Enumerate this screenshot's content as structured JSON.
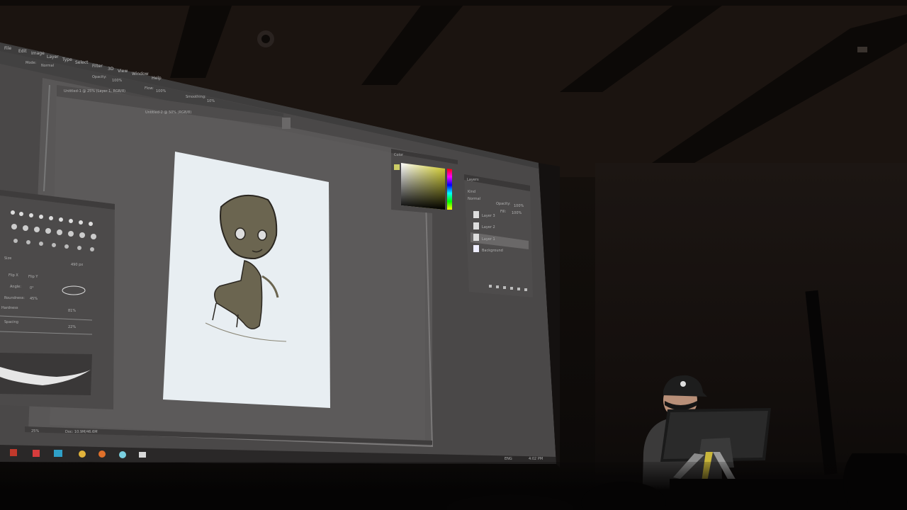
{
  "scene": {
    "description_type": "photo-of-projected-screen",
    "app": "Photoshop"
  },
  "menu_bar": {
    "items": [
      "File",
      "Edit",
      "Image",
      "Layer",
      "Type",
      "Select",
      "Filter",
      "3D",
      "View",
      "Window",
      "Help"
    ]
  },
  "options_bar": {
    "mode_label": "Mode:",
    "mode_value": "Normal",
    "opacity_label": "Opacity:",
    "opacity_value": "100%",
    "flow_label": "Flow:",
    "flow_value": "100%",
    "smoothing_label": "Smoothing:",
    "smoothing_value": "10%"
  },
  "documents": {
    "tab1": "Untitled-1 @ 25% (Layer 1, RGB/8)",
    "tab2": "Untitled-2 @ 50% (RGB/8)"
  },
  "status_bar": {
    "zoom": "25%",
    "doc": "Doc: 10.9M/46.6M"
  },
  "brush_panel": {
    "size_label": "Size",
    "size_value": "490 px",
    "flip_x": "Flip X",
    "flip_y": "Flip Y",
    "angle_label": "Angle:",
    "angle_value": "0°",
    "roundness_label": "Roundness:",
    "roundness_value": "45%",
    "hardness_label": "Hardness",
    "hardness_value": "81%",
    "spacing_label": "Spacing",
    "spacing_value": "22%"
  },
  "layers_panel": {
    "title": "Layers",
    "kind_label": "Kind",
    "blend_mode": "Normal",
    "opacity_label": "Opacity:",
    "opacity_value": "100%",
    "fill_label": "Fill:",
    "fill_value": "100%",
    "layers": [
      "Layer 3",
      "Layer 2",
      "Layer 1",
      "Background"
    ],
    "selected_index": 2
  },
  "color_panel": {
    "title": "Color"
  },
  "taskbar": {
    "time": "4:02 PM",
    "lang": "ENG"
  },
  "colors": {
    "ps_bg": "#5a5858",
    "panel": "#545252",
    "canvas": "#e8eef2",
    "sketch_fill": "#6b6550",
    "sketch_line": "#2a2620",
    "ps_blue": "#2fa0c8",
    "hue_bar": "#e8e33a"
  }
}
